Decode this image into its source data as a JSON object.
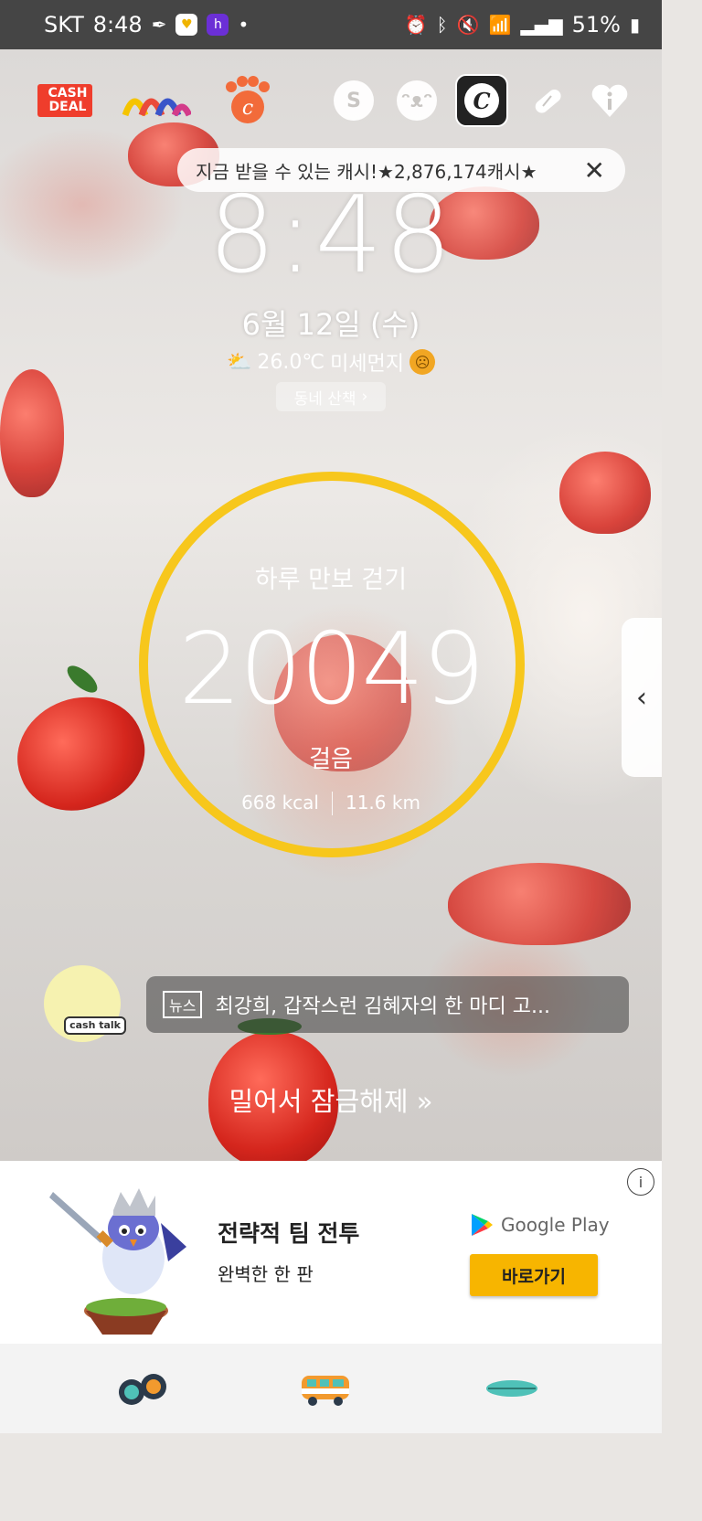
{
  "status_bar": {
    "carrier": "SKT",
    "time": "8:48",
    "battery": "51%"
  },
  "app_shortcuts": {
    "cashdeal_label": "CASH\nDEAL"
  },
  "cash_banner": {
    "text": "지금 받을 수 있는 캐시!★2,876,174캐시★",
    "close": "✕"
  },
  "lockscreen": {
    "clock": "8:48",
    "date": "6월 12일 (수)",
    "temperature": "26.0℃",
    "dust_label": "미세먼지",
    "walk_button": "동네 산책"
  },
  "pedometer": {
    "title": "하루 만보 걷기",
    "steps": "20049",
    "unit": "걸음",
    "kcal": "668 kcal",
    "distance": "11.6 km"
  },
  "news": {
    "tag": "뉴스",
    "headline": "최강희, 갑작스런 김혜자의 한 마디 고...",
    "badge": "cash talk"
  },
  "unlock": {
    "label": "밀어서 잠금해제 "
  },
  "ad": {
    "info": "i",
    "title": "전략적 팀 전투",
    "subtitle": "완벽한 한 판",
    "store": "Google Play",
    "cta": "바로가기"
  }
}
